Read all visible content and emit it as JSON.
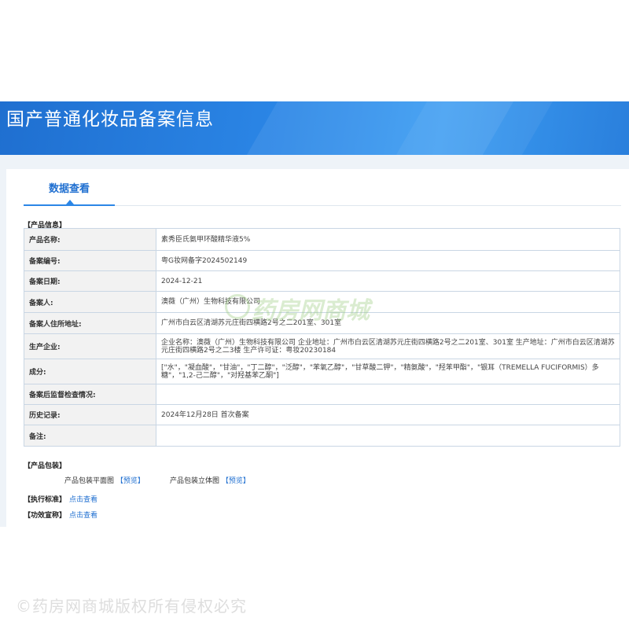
{
  "header": {
    "title": "国产普通化妆品备案信息"
  },
  "tab": {
    "label": "数据查看"
  },
  "product_info": {
    "section_label": "【产品信息】",
    "rows": [
      {
        "key": "产品名称:",
        "value": "素秀臣氏氨甲环酸精华液5%"
      },
      {
        "key": "备案编号:",
        "value": "粤G妆网备字2024502149"
      },
      {
        "key": "备案日期:",
        "value": "2024-12-21"
      },
      {
        "key": "备案人:",
        "value": "澳薇（广州）生物科技有限公司"
      },
      {
        "key": "备案人住所地址:",
        "value": "广州市白云区清湖苏元庄街四横路2号之二201室、301室"
      },
      {
        "key": "生产企业:",
        "value": "企业名称：澳薇（广州）生物科技有限公司 企业地址：广州市白云区清湖苏元庄街四横路2号之二201室、301室 生产地址：广州市白云区清湖苏元庄街四横路2号之二3楼 生产许可证：粤妆20230184"
      },
      {
        "key": "成分:",
        "value": "[\"水\"，\"凝血酸\"，\"甘油\"，\"丁二醇\"，\"泛醇\"，\"苯氧乙醇\"，\"甘草酸二钾\"，\"精氨酸\"，\"羟苯甲酯\"，\"银耳（TREMELLA FUCIFORMIS）多糖\"，\"1,2-己二醇\"，\"对羟基苯乙酮\"]"
      },
      {
        "key": "备案后监督检查情况:",
        "value": ""
      },
      {
        "key": "历史记录:",
        "value": "2024年12月28日 首次备案"
      },
      {
        "key": "备注:",
        "value": ""
      }
    ]
  },
  "packaging": {
    "section_label": "【产品包装】",
    "flat_label": "产品包装平面图",
    "solid_label": "产品包装立体图",
    "preview_label": "预览",
    "open_bracket": "【",
    "close_bracket": "】"
  },
  "standard": {
    "label": "【执行标准】",
    "link": "点击查看"
  },
  "efficacy": {
    "label": "【功效宣称】",
    "link": "点击查看"
  },
  "watermarks": {
    "center": "药房网商城",
    "bottom": "©药房网商城版权所有侵权必究"
  }
}
